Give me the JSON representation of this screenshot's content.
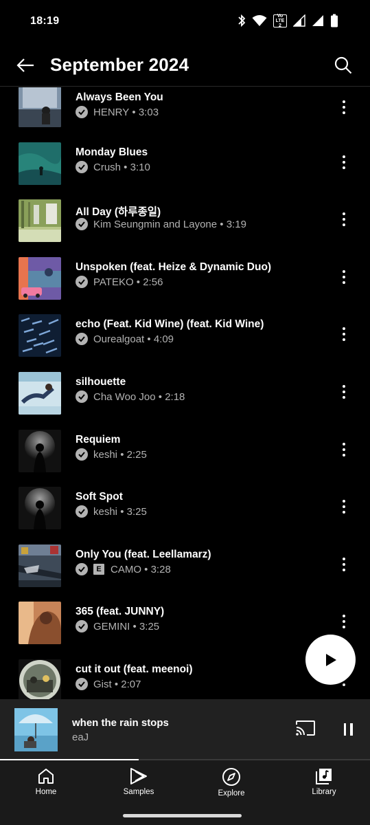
{
  "status_bar": {
    "time": "18:19",
    "volte_top": "Vo",
    "volte_bottom": "LTE 2"
  },
  "header": {
    "title": "September 2024"
  },
  "songs": [
    {
      "title": "Always Been You",
      "artist": "HENRY",
      "duration": "3:03",
      "explicit": false
    },
    {
      "title": "Monday Blues",
      "artist": "Crush",
      "duration": "3:10",
      "explicit": false
    },
    {
      "title": "All Day (하루종일)",
      "artist": "Kim Seungmin and Layone",
      "duration": "3:19",
      "explicit": false
    },
    {
      "title": "Unspoken (feat. Heize & Dynamic Duo)",
      "artist": "PATEKO",
      "duration": "2:56",
      "explicit": false
    },
    {
      "title": "echo (Feat. Kid Wine) (feat. Kid Wine)",
      "artist": "Ourealgoat",
      "duration": "4:09",
      "explicit": false
    },
    {
      "title": "silhouette",
      "artist": "Cha Woo Joo",
      "duration": "2:18",
      "explicit": false
    },
    {
      "title": "Requiem",
      "artist": "keshi",
      "duration": "2:25",
      "explicit": false
    },
    {
      "title": "Soft Spot",
      "artist": "keshi",
      "duration": "3:25",
      "explicit": false
    },
    {
      "title": "Only You (feat. Leellamarz)",
      "artist": "CAMO",
      "duration": "3:28",
      "explicit": true,
      "explicit_label": "E"
    },
    {
      "title": "365 (feat. JUNNY)",
      "artist": "GEMINI",
      "duration": "3:25",
      "explicit": false
    },
    {
      "title": "cut it out (feat. meenoi)",
      "artist": "Gist",
      "duration": "2:07",
      "explicit": false
    }
  ],
  "now_playing": {
    "title": "when the rain stops",
    "artist": "eaJ",
    "progress_fraction": 0.375
  },
  "nav": [
    {
      "label": "Home",
      "icon": "home-icon"
    },
    {
      "label": "Samples",
      "icon": "samples-icon"
    },
    {
      "label": "Explore",
      "icon": "compass-icon"
    },
    {
      "label": "Library",
      "icon": "library-icon"
    }
  ],
  "colors": {
    "background": "#000000",
    "mini_player": "#212121",
    "nav": "#1a1a1a",
    "secondary_text": "#b3b3b3"
  }
}
